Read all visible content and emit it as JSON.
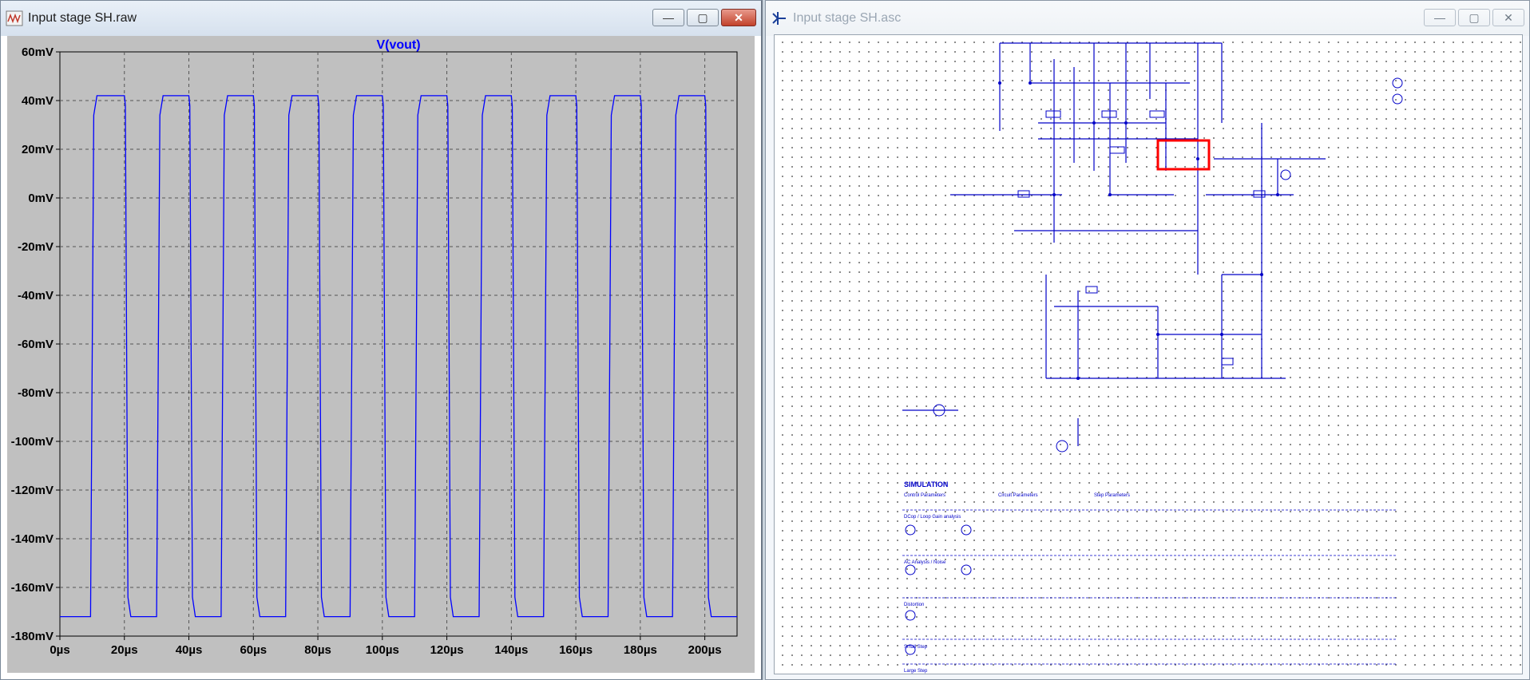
{
  "left_window": {
    "title": "Input stage SH.raw",
    "icon": "waveform-viewer-icon",
    "buttons": {
      "minimize": "—",
      "maximize": "▢",
      "close": "✕"
    }
  },
  "right_window": {
    "title": "Input stage SH.asc",
    "icon": "schematic-editor-icon",
    "buttons": {
      "minimize": "—",
      "maximize": "▢",
      "close": "✕"
    }
  },
  "chart_data": {
    "type": "line",
    "title": "V(vout)",
    "xlabel": "",
    "ylabel": "",
    "xlim": [
      0,
      210
    ],
    "ylim": [
      -180,
      60
    ],
    "x_unit": "µs",
    "y_unit": "mV",
    "x_ticks": [
      "0µs",
      "20µs",
      "40µs",
      "60µs",
      "80µs",
      "100µs",
      "120µs",
      "140µs",
      "160µs",
      "180µs",
      "200µs"
    ],
    "y_ticks": [
      "60mV",
      "40mV",
      "20mV",
      "0mV",
      "-20mV",
      "-40mV",
      "-60mV",
      "-80mV",
      "-100mV",
      "-120mV",
      "-140mV",
      "-160mV",
      "-180mV"
    ],
    "grid": true,
    "background": "#c0c0c0",
    "series": [
      {
        "color": "#0000ff",
        "x": [
          0,
          9.5,
          10.5,
          11.5,
          20,
          20.3,
          21.1,
          22,
          30,
          31,
          32,
          40,
          40.3,
          41.1,
          42,
          50,
          51,
          52,
          60,
          60.3,
          61.1,
          62,
          70,
          71,
          72,
          80,
          80.3,
          81.1,
          82,
          90,
          91,
          92,
          100,
          100.3,
          101.1,
          102,
          110,
          111,
          112,
          120,
          120.3,
          121.1,
          122,
          130,
          131,
          132,
          140,
          140.3,
          141.1,
          142,
          150,
          151,
          152,
          160,
          160.3,
          161.1,
          162,
          170,
          171,
          172,
          180,
          180.3,
          181.1,
          182,
          190,
          191,
          192,
          200,
          200.3,
          201.1,
          202,
          210
        ],
        "y": [
          -172,
          -172,
          34,
          42,
          42,
          38,
          -164,
          -172,
          -172,
          34,
          42,
          42,
          38,
          -164,
          -172,
          -172,
          34,
          42,
          42,
          38,
          -164,
          -172,
          -172,
          34,
          42,
          42,
          38,
          -164,
          -172,
          -172,
          34,
          42,
          42,
          38,
          -164,
          -172,
          -172,
          34,
          42,
          42,
          38,
          -164,
          -172,
          -172,
          34,
          42,
          42,
          38,
          -164,
          -172,
          -172,
          34,
          42,
          42,
          38,
          -164,
          -172,
          -172,
          34,
          42,
          42,
          38,
          -164,
          -172,
          -172,
          34,
          42,
          42,
          38,
          -164,
          -172,
          -172
        ]
      }
    ]
  },
  "schematic": {
    "highlight_color": "#ff0000",
    "wire_color": "#0000c8",
    "labels": {
      "simulation": "SIMULATION",
      "control_parameters": "Control Parameters",
      "circuit_parameters": "Circuit Parameters",
      "step_parameters": "Step Parameters",
      "dc_loop": "DCop / Loop Gain analysis",
      "ac_analysis": "AC Analysis / Noise",
      "distortion": "Distortion",
      "small_step": "Small Step",
      "large_step": "Large Step"
    }
  }
}
